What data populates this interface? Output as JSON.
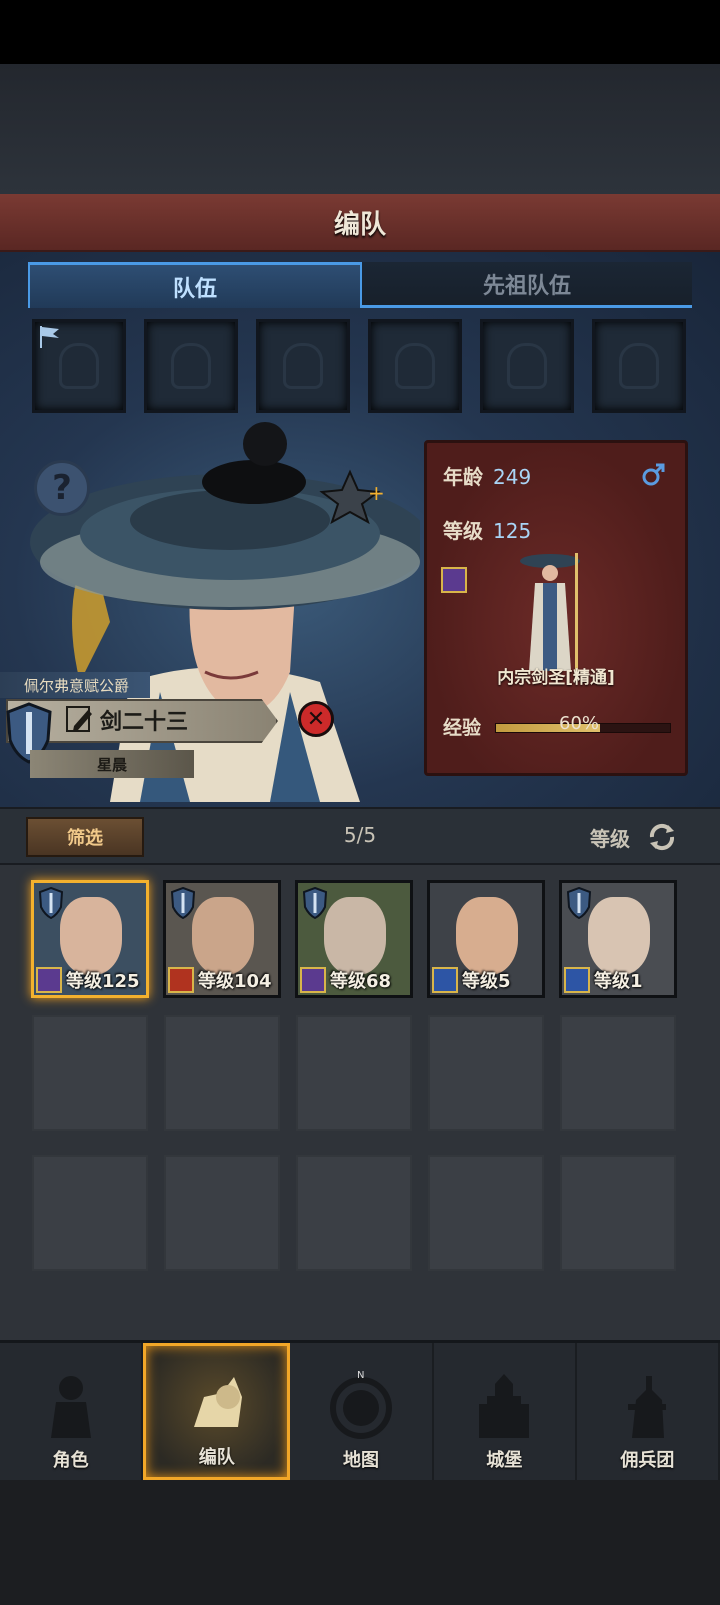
{
  "header": {
    "title": "编队"
  },
  "tabs": [
    {
      "label": "队伍",
      "active": true
    },
    {
      "label": "先祖队伍",
      "active": false
    }
  ],
  "team_slots": 6,
  "character": {
    "title_top": "佩尔弗意赋公爵",
    "name": "剑二十三",
    "title_bottom": "星晨",
    "age_label": "年龄",
    "age": "249",
    "level_label": "等级",
    "level": "125",
    "class_name": "内宗剑圣[精通]",
    "exp_label": "经验",
    "exp_percent": 60,
    "exp_text": "60%"
  },
  "filter": {
    "button": "筛选",
    "count": "5/5",
    "sort_label": "等级"
  },
  "roster": [
    {
      "level": "等级125",
      "selected": true
    },
    {
      "level": "等级104",
      "selected": false
    },
    {
      "level": "等级68",
      "selected": false
    },
    {
      "level": "等级5",
      "selected": false
    },
    {
      "level": "等级1",
      "selected": false
    }
  ],
  "nav": [
    {
      "label": "角色",
      "icon": "knight-icon",
      "active": false
    },
    {
      "label": "编队",
      "icon": "formation-icon",
      "active": true
    },
    {
      "label": "地图",
      "icon": "compass-map-icon",
      "active": false
    },
    {
      "label": "城堡",
      "icon": "castle-icon",
      "active": false
    },
    {
      "label": "佣兵团",
      "icon": "mercenary-icon",
      "active": false
    }
  ],
  "colors": {
    "accent": "#f3b12e",
    "tab_blue": "#4a9ae6",
    "header_red": "#7a3a33"
  }
}
